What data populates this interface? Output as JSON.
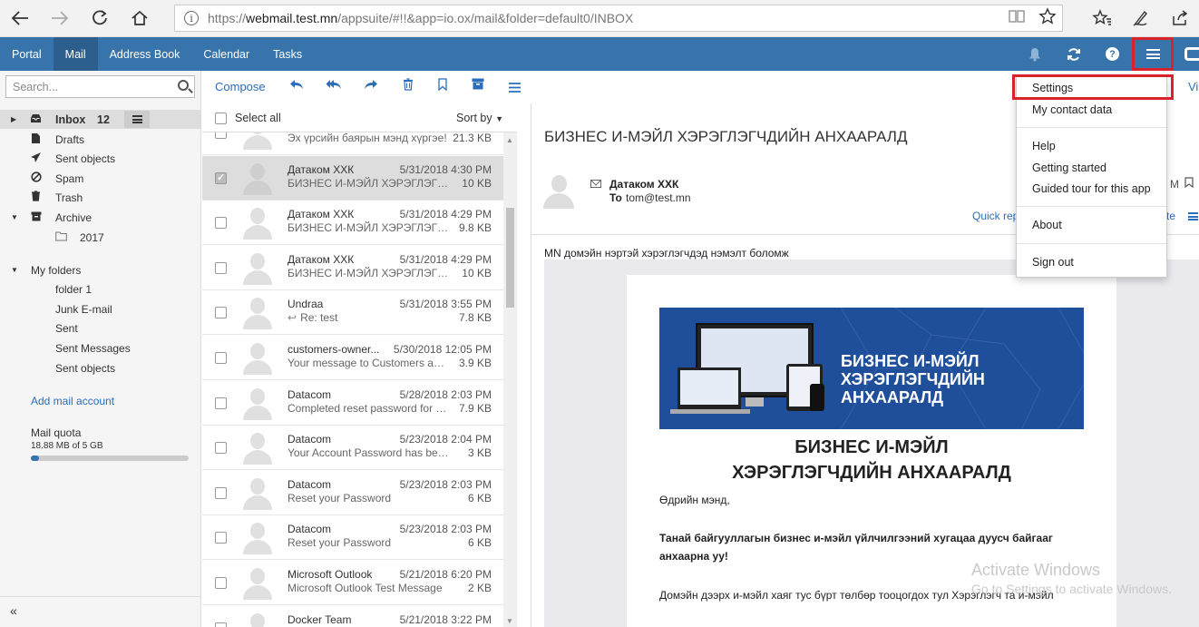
{
  "browser": {
    "url_prefix": "https://",
    "url_host": "webmail.test.mn",
    "url_path": "/appsuite/#!!&app=io.ox/mail&folder=default0/INBOX"
  },
  "topbar": {
    "tabs": [
      {
        "label": "Portal",
        "active": false
      },
      {
        "label": "Mail",
        "active": true
      },
      {
        "label": "Address Book",
        "active": false
      },
      {
        "label": "Calendar",
        "active": false
      },
      {
        "label": "Tasks",
        "active": false
      }
    ],
    "help_glyph": "?"
  },
  "sidebar": {
    "search_placeholder": "Search...",
    "inbox_label": "Inbox",
    "inbox_count": "12",
    "folders": [
      "Drafts",
      "Sent objects",
      "Spam",
      "Trash",
      "Archive"
    ],
    "archive_sub": "2017",
    "my_folders_label": "My folders",
    "my_folders": [
      "folder 1",
      "Junk E-mail",
      "Sent",
      "Sent Messages",
      "Sent objects"
    ],
    "add_account": "Add mail account",
    "quota_label": "Mail quota",
    "quota_value": "18.88 MB of 5 GB",
    "quota_fraction": 0.004,
    "collapse": "«"
  },
  "toolbar": {
    "compose": "Compose",
    "view_frag": "Vi"
  },
  "list": {
    "select_all": "Select all",
    "sort_by": "Sort by",
    "rows": [
      {
        "from": "",
        "date": "",
        "subject": "Эх үрсийн баярын мэнд хүргэе!",
        "size": "21.3 KB",
        "selected": false,
        "reply": false
      },
      {
        "from": "Датаком ХХК",
        "date": "5/31/2018 4:30 PM",
        "subject": "БИЗНЕС И-МЭЙЛ ХЭРЭГЛЭГЧДИЙН АНХААРАЛД",
        "size": "10 KB",
        "selected": true,
        "reply": false
      },
      {
        "from": "Датаком ХХК",
        "date": "5/31/2018 4:29 PM",
        "subject": "БИЗНЕС И-МЭЙЛ ХЭРЭГЛЭГЧДИЙН АНХААРАЛД",
        "size": "9.8 KB",
        "selected": false,
        "reply": false
      },
      {
        "from": "Датаком ХХК",
        "date": "5/31/2018 4:29 PM",
        "subject": "БИЗНЕС И-МЭЙЛ ХЭРЭГЛЭГЧДИЙН АНХААРАЛД",
        "size": "10 KB",
        "selected": false,
        "reply": false
      },
      {
        "from": "Undraa",
        "date": "5/31/2018 3:55 PM",
        "subject": "Re: test",
        "size": "7.8 KB",
        "selected": false,
        "reply": true
      },
      {
        "from": "customers-owner...",
        "date": "5/30/2018 12:05 PM",
        "subject": "Your message to Customers awaits moderator approval",
        "size": "3.9 KB",
        "selected": false,
        "reply": false
      },
      {
        "from": "Datacom",
        "date": "5/28/2018 2:03 PM",
        "subject": "Completed reset password for hours",
        "size": "7.9 KB",
        "selected": false,
        "reply": false
      },
      {
        "from": "Datacom",
        "date": "5/23/2018 2:04 PM",
        "subject": "Your Account Password has been reset",
        "size": "3 KB",
        "selected": false,
        "reply": false
      },
      {
        "from": "Datacom",
        "date": "5/23/2018 2:03 PM",
        "subject": "Reset your Password",
        "size": "6 KB",
        "selected": false,
        "reply": false
      },
      {
        "from": "Datacom",
        "date": "5/23/2018 2:03 PM",
        "subject": "Reset your Password",
        "size": "6 KB",
        "selected": false,
        "reply": false
      },
      {
        "from": "Microsoft Outlook",
        "date": "5/21/2018 6:20 PM",
        "subject": "Microsoft Outlook Test Message",
        "size": "2 KB",
        "selected": false,
        "reply": false
      },
      {
        "from": "Docker Team",
        "date": "5/21/2018 3:22 PM",
        "subject": "",
        "size": "",
        "selected": false,
        "reply": false
      }
    ]
  },
  "reader": {
    "subject": "БИЗНЕС И-МЭЙЛ ХЭРЭГЛЭГЧДИЙН АНХААРАЛД",
    "sender": "Датаком ХХК",
    "to_label": "To",
    "to_value": "tom@test.mn",
    "quick_reply": "Quick rep",
    "date_frag": "M",
    "te_frag": "te",
    "intro": "MN домэйн нэртэй хэрэглэгчдэд нэмэлт боломж",
    "banner_line1": "БИЗНЕС И-МЭЙЛ",
    "banner_line2": "ХЭРЭГЛЭГЧДИЙН АНХААРАЛД",
    "card_title_line1": "БИЗНЕС И-МЭЙЛ",
    "card_title_line2": "ХЭРЭГЛЭГЧДИЙН АНХААРАЛД",
    "greeting": "Өдрийн мэнд,",
    "bold_para": "Танай байгууллагын бизнес и-мэйл үйлчилгээний хугацаа дуусч байгааг анхаарна уу!",
    "para": "Домэйн дээрх и-мэйл хаяг тус бүрт төлбөр тооцогдох тул Хэрэглэгч та и-мэйл"
  },
  "dropdown": {
    "items": [
      "Settings",
      "My contact data",
      "Help",
      "Getting started",
      "Guided tour for this app",
      "About",
      "Sign out"
    ]
  },
  "watermark": {
    "line1": "Activate Windows",
    "line2": "Go to Settings to activate Windows."
  },
  "colors": {
    "topbar": "#3774ab",
    "active_tab": "#2d5f8e",
    "link": "#2a6ebb",
    "highlight_red": "#d8232a"
  }
}
